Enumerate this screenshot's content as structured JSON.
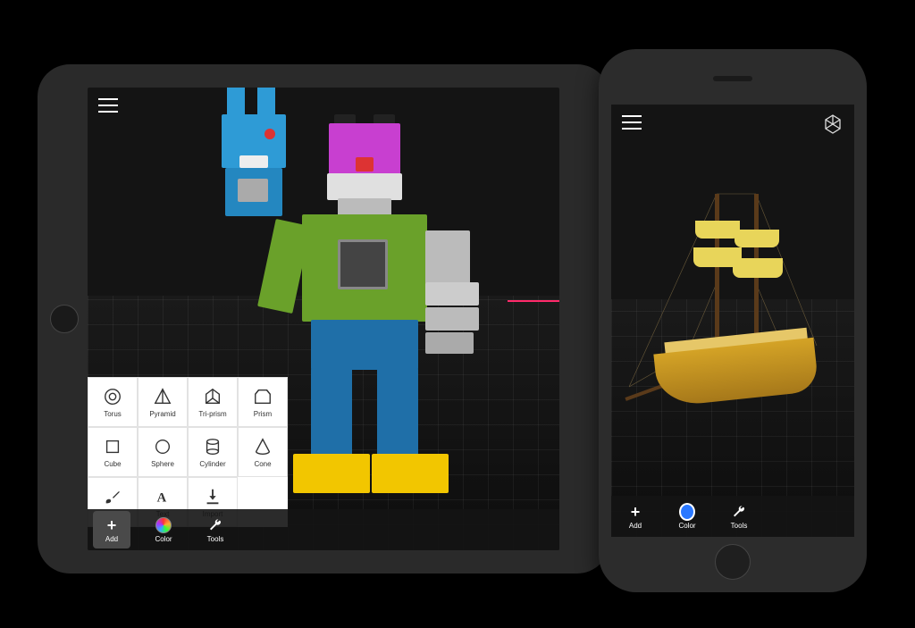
{
  "tablet": {
    "shapes": [
      {
        "key": "torus",
        "label": "Torus"
      },
      {
        "key": "pyramid",
        "label": "Pyramid"
      },
      {
        "key": "triprism",
        "label": "Tri-prism"
      },
      {
        "key": "prism",
        "label": "Prism"
      },
      {
        "key": "cube",
        "label": "Cube"
      },
      {
        "key": "sphere",
        "label": "Sphere"
      },
      {
        "key": "cylinder",
        "label": "Cylinder"
      },
      {
        "key": "cone",
        "label": "Cone"
      },
      {
        "key": "draw",
        "label": "Draw"
      },
      {
        "key": "text",
        "label": "Text"
      },
      {
        "key": "import",
        "label": "Import"
      }
    ],
    "toolbar": {
      "add": "Add",
      "color": "Color",
      "tools": "Tools"
    }
  },
  "phone": {
    "toolbar": {
      "add": "Add",
      "color": "Color",
      "tools": "Tools"
    }
  }
}
